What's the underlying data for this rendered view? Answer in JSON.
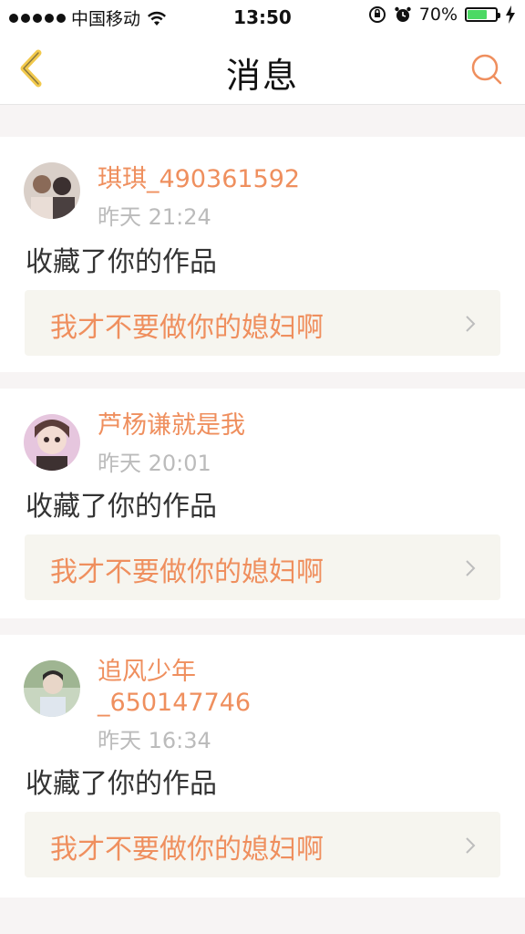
{
  "status_bar": {
    "carrier": "中国移动",
    "time": "13:50",
    "battery_percent": "70%",
    "battery_level": 0.7,
    "battery_color": "#4cd964"
  },
  "navbar": {
    "title": "消息",
    "back_icon": "chevron-left-icon",
    "search_icon": "search-icon",
    "accent_color": "#ef8f5e",
    "back_color": "#f2c94c"
  },
  "messages": [
    {
      "username": "琪琪_490361592",
      "time": "昨天 21:24",
      "action": "收藏了你的作品",
      "work_title": "我才不要做你的媳妇啊"
    },
    {
      "username": "芦杨谦就是我",
      "time": "昨天 20:01",
      "action": "收藏了你的作品",
      "work_title": "我才不要做你的媳妇啊"
    },
    {
      "username_line1": "追风少年",
      "username_line2": "_650147746",
      "time": "昨天 16:34",
      "action": "收藏了你的作品",
      "work_title": "我才不要做你的媳妇啊"
    }
  ]
}
